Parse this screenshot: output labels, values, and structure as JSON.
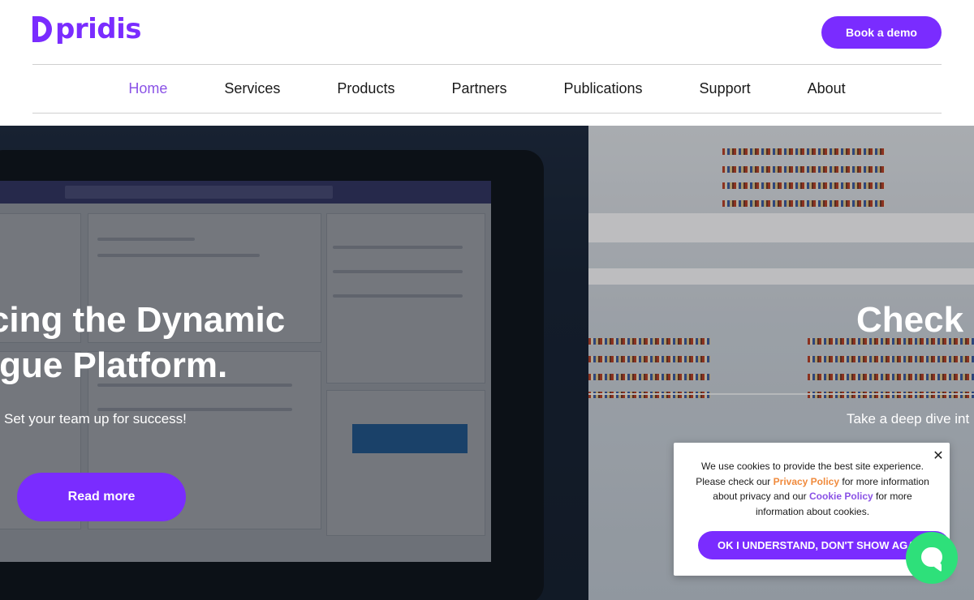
{
  "header": {
    "logo_text": "pridis",
    "cta_label": "Book a demo"
  },
  "nav": {
    "items": [
      {
        "label": "Home",
        "active": true
      },
      {
        "label": "Services",
        "active": false
      },
      {
        "label": "Products",
        "active": false
      },
      {
        "label": "Partners",
        "active": false
      },
      {
        "label": "Publications",
        "active": false
      },
      {
        "label": "Support",
        "active": false
      },
      {
        "label": "About",
        "active": false
      }
    ]
  },
  "hero_left": {
    "title_line1": "ucing the Dynamic",
    "title_line2": "logue Platform.",
    "subtitle": "Set your team up for success!",
    "button_label": "Read more"
  },
  "hero_right": {
    "title": "Check o",
    "subtitle": "Take a deep dive int"
  },
  "cookie": {
    "text_part1": "We use cookies to provide the best site experience. Please check our ",
    "privacy_link": "Privacy Policy",
    "text_part2": " for more information about privacy and our ",
    "cookie_link": "Cookie Policy",
    "text_part3": " for more information about cookies.",
    "button_label": "OK I UNDERSTAND, DON'T SHOW AGAIN"
  },
  "colors": {
    "brand_purple": "#7a2cff",
    "nav_active": "#8a52e6",
    "link_orange": "#f08a3c",
    "chat_green": "#2ee07a"
  },
  "icons": {
    "close": "close-icon",
    "chat": "chat-bubble-icon"
  }
}
